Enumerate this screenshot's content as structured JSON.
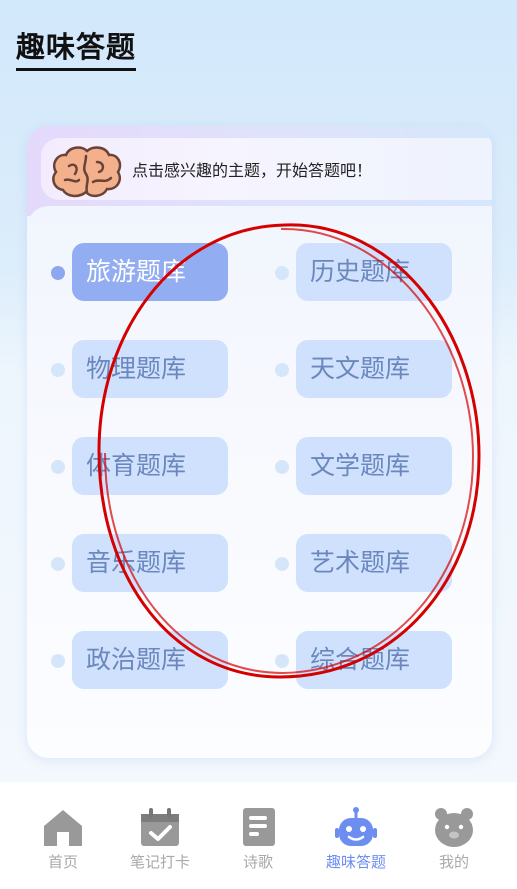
{
  "page": {
    "title": "趣味答题"
  },
  "banner": {
    "text": "点击感兴趣的主题，开始答题吧！",
    "icon": "brain-icon"
  },
  "topics": [
    {
      "label": "旅游题库",
      "active": true
    },
    {
      "label": "历史题库",
      "active": false
    },
    {
      "label": "物理题库",
      "active": false
    },
    {
      "label": "天文题库",
      "active": false
    },
    {
      "label": "体育题库",
      "active": false
    },
    {
      "label": "文学题库",
      "active": false
    },
    {
      "label": "音乐题库",
      "active": false
    },
    {
      "label": "艺术题库",
      "active": false
    },
    {
      "label": "政治题库",
      "active": false
    },
    {
      "label": "综合题库",
      "active": false
    }
  ],
  "tabbar": {
    "items": [
      {
        "label": "首页",
        "icon": "home-icon",
        "active": false
      },
      {
        "label": "笔记打卡",
        "icon": "calendar-check-icon",
        "active": false
      },
      {
        "label": "诗歌",
        "icon": "document-icon",
        "active": false
      },
      {
        "label": "趣味答题",
        "icon": "robot-icon",
        "active": true
      },
      {
        "label": "我的",
        "icon": "bear-face-icon",
        "active": false
      }
    ]
  },
  "colors": {
    "accent": "#6d8ef0",
    "topic_bg": "#cfe1fc",
    "topic_active_bg": "#92adf2",
    "topic_text": "#6b87bd",
    "tab_inactive": "#a9a9a9",
    "annotation_circle": "#d50000"
  }
}
